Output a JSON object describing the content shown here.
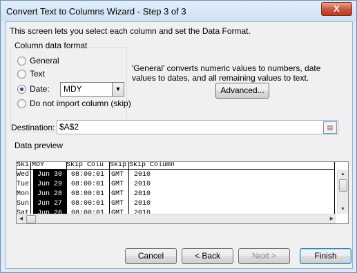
{
  "window": {
    "title": "Convert Text to Columns Wizard - Step 3 of 3",
    "close_glyph": "X"
  },
  "instructions": "This screen lets you select each column and set the Data Format.",
  "column_format": {
    "legend": "Column data format",
    "options": {
      "general": "General",
      "text": "Text",
      "date": "Date:",
      "skip": "Do not import column (skip)"
    },
    "selected": "date",
    "date_format": "MDY",
    "dropdown_glyph": "▼"
  },
  "info_text": "'General' converts numeric values to numbers, date values to dates, and all remaining values to text.",
  "advanced_label": "Advanced...",
  "destination": {
    "label": "Destination:",
    "value": "$A$2"
  },
  "preview": {
    "legend": "Data preview",
    "headers": [
      "Ski",
      "MDY",
      "Skip Colu",
      "Skip",
      "Skip Column"
    ],
    "rows": [
      [
        "Wed",
        "Jun 30",
        "08:00:01",
        "GMT",
        "2010"
      ],
      [
        "Tue",
        "Jun 29",
        "08:00:01",
        "GMT",
        "2010"
      ],
      [
        "Mon",
        "Jun 28",
        "08:00:01",
        "GMT",
        "2010"
      ],
      [
        "Sun",
        "Jun 27",
        "08:00:01",
        "GMT",
        "2010"
      ],
      [
        "Sat",
        "Jun 26",
        "08:00:01",
        "GMT",
        "2010"
      ]
    ]
  },
  "buttons": {
    "cancel": "Cancel",
    "back": "< Back",
    "next": "Next >",
    "finish": "Finish"
  }
}
